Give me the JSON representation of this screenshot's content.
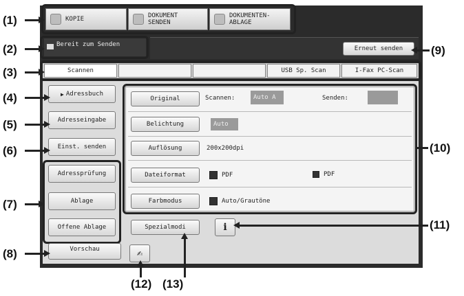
{
  "callouts": {
    "c1": "(1)",
    "c2": "(2)",
    "c3": "(3)",
    "c4": "(4)",
    "c5": "(5)",
    "c6": "(6)",
    "c7": "(7)",
    "c8": "(8)",
    "c9": "(9)",
    "c10": "(10)",
    "c11": "(11)",
    "c12": "(12)",
    "c13": "(13)"
  },
  "modes": {
    "kopie": "KOPIE",
    "senden": "DOKUMENT\nSENDEN",
    "ablage": "DOKUMENTEN-\nABLAGE"
  },
  "status": {
    "text": "Bereit zum Senden",
    "resend": "Erneut senden"
  },
  "tabs": {
    "scannen": "Scannen",
    "tab2": "",
    "tab3": "",
    "usb": "USB Sp. Scan",
    "ifax": "I-Fax PC-Scan"
  },
  "left": {
    "adressbuch": "Adressbuch",
    "adresseingabe": "Adresseingabe",
    "einst_senden": "Einst. senden",
    "adresspruefung": "Adressprüfung",
    "ablage": "Ablage",
    "offene_ablage": "Offene Ablage",
    "vorschau": "Vorschau"
  },
  "settings": {
    "original": "Original",
    "scannen_label": "Scannen:",
    "scannen_value": "Auto A",
    "senden_label": "Senden:",
    "belichtung": "Belichtung",
    "belichtung_value": "Auto",
    "aufloesung": "Auflösung",
    "aufloesung_value": "200x200dpi",
    "dateiformat": "Dateiformat",
    "format_value1": "PDF",
    "format_value2": "PDF",
    "farbmodus": "Farbmodus",
    "farbmodus_value": "Auto/Grautöne",
    "spezialmodi": "Spezialmodi",
    "info": "i"
  }
}
